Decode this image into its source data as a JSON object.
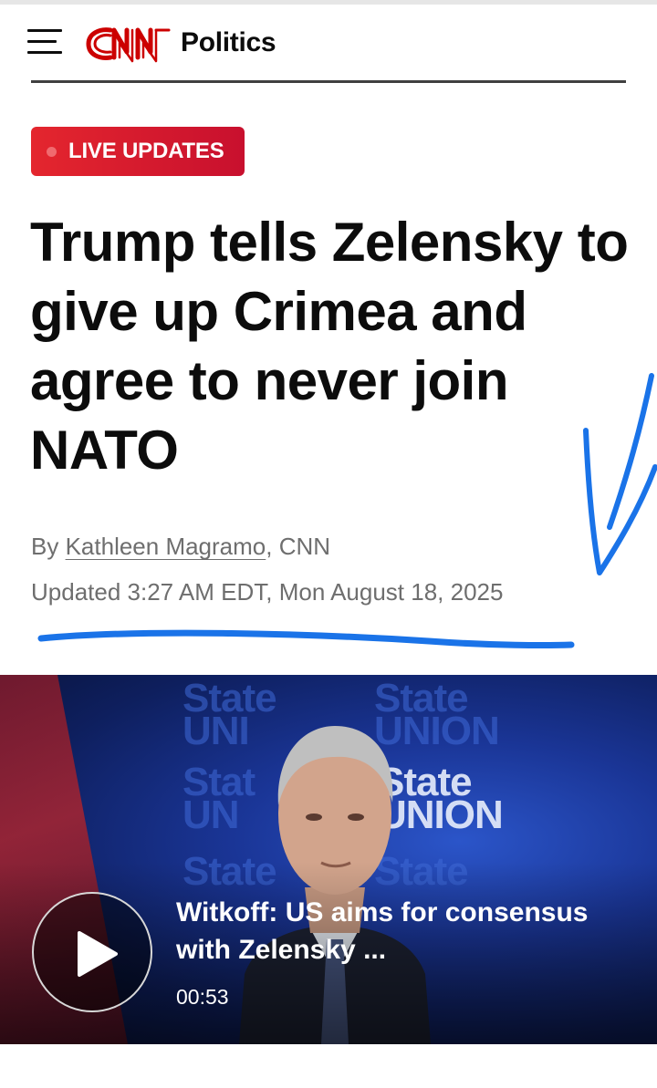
{
  "header": {
    "menu_icon": "hamburger-menu-icon",
    "logo_text": "CNN",
    "section": "Politics"
  },
  "article": {
    "badge": "LIVE UPDATES",
    "headline": "Trump tells Zelensky to give up Crimea and agree to never join NATO",
    "byline_prefix": "By ",
    "author": "Kathleen Magramo",
    "byline_suffix": ", CNN",
    "updated": "Updated 3:27 AM EDT, Mon August 18, 2025"
  },
  "video": {
    "play_icon": "play-icon",
    "title": "Witkoff: US aims for consensus with Zelensky ...",
    "duration": "00:53",
    "background_text": "State of the UNION"
  },
  "colors": {
    "brand_red": "#cc0000",
    "badge_red": "#d71a2a",
    "annotation_blue": "#1a73e8",
    "video_blue": "#1a3596"
  }
}
